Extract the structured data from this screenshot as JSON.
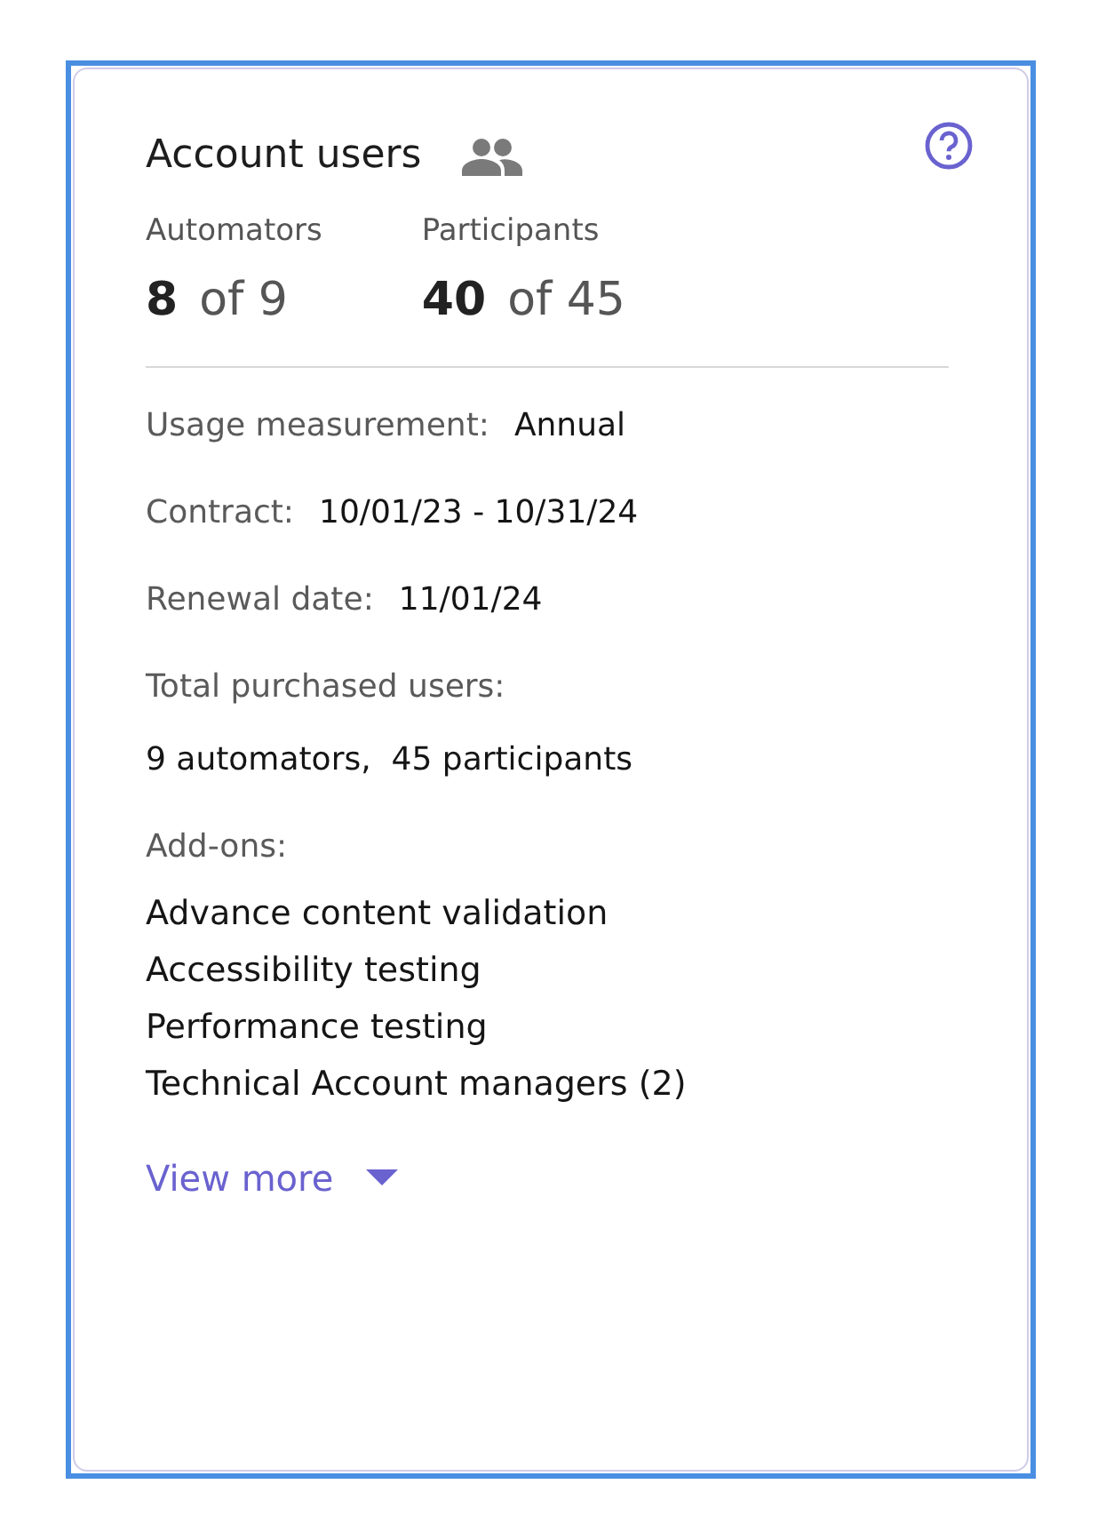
{
  "card": {
    "title": "Account users",
    "stats": [
      {
        "label": "Automators",
        "count": "8",
        "total": "of 9"
      },
      {
        "label": "Participants",
        "count": "40",
        "total": "of 45"
      }
    ],
    "details": [
      {
        "kind": "inline",
        "label": "Usage measurement:",
        "value": "Annual"
      },
      {
        "kind": "inline",
        "label": "Contract:",
        "value": "10/01/23 - 10/31/24"
      },
      {
        "kind": "inline",
        "label": "Renewal date:",
        "value": "11/01/24"
      },
      {
        "kind": "stacked",
        "label": "Total purchased users:",
        "value": "9 automators,  45 participants"
      }
    ],
    "addons": {
      "label": "Add-ons:",
      "items": [
        "Advance content validation",
        "Accessibility testing",
        "Performance testing",
        "Technical Account managers (2)"
      ]
    },
    "view_more": "View more"
  }
}
